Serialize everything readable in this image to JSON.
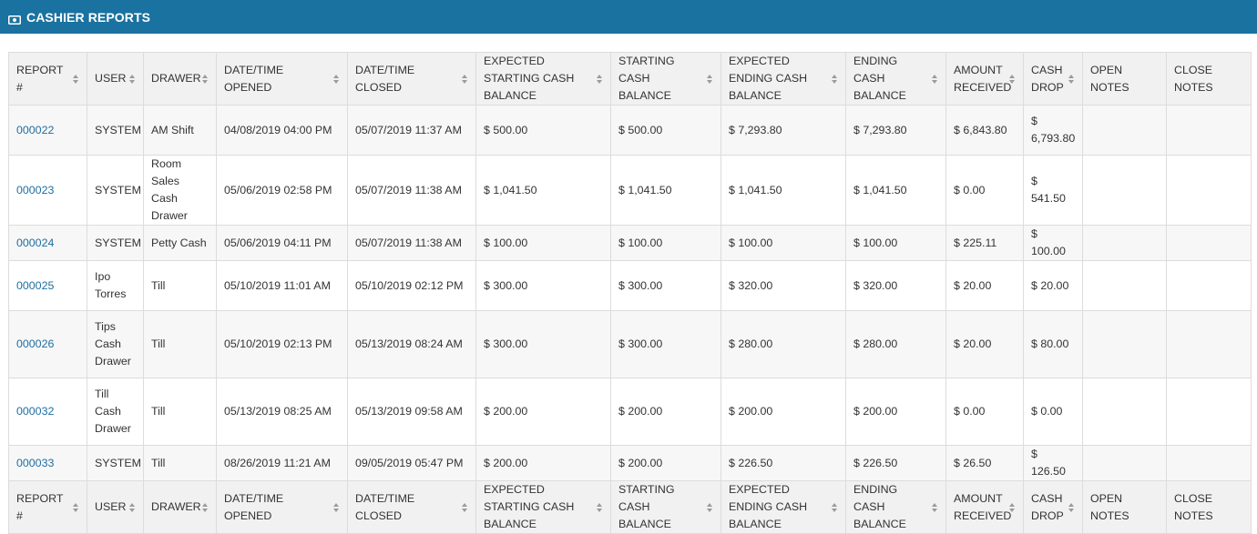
{
  "header": {
    "title": "CASHIER REPORTS",
    "icon": "money-icon"
  },
  "columns": [
    "REPORT #",
    "USER",
    "DRAWER",
    "DATE/TIME OPENED",
    "DATE/TIME CLOSED",
    "EXPECTED STARTING CASH BALANCE",
    "STARTING CASH BALANCE",
    "EXPECTED ENDING CASH BALANCE",
    "ENDING CASH BALANCE",
    "AMOUNT RECEIVED",
    "CASH DROP",
    "OPEN NOTES",
    "CLOSE NOTES"
  ],
  "rows": [
    {
      "report": "000022",
      "user": "SYSTEM",
      "drawer": "AM Shift",
      "opened": "04/08/2019 04:00 PM",
      "closed": "05/07/2019 11:37 AM",
      "exp_start": "$ 500.00",
      "start": "$ 500.00",
      "exp_end": "$ 7,293.80",
      "end": "$ 7,293.80",
      "received": "$ 6,843.80",
      "drop": "$ 6,793.80",
      "open_notes": "",
      "close_notes": ""
    },
    {
      "report": "000023",
      "user": "SYSTEM",
      "drawer": "Room Sales Cash Drawer",
      "opened": "05/06/2019 02:58 PM",
      "closed": "05/07/2019 11:38 AM",
      "exp_start": "$ 1,041.50",
      "start": "$ 1,041.50",
      "exp_end": "$ 1,041.50",
      "end": "$ 1,041.50",
      "received": "$ 0.00",
      "drop": "$ 541.50",
      "open_notes": "",
      "close_notes": ""
    },
    {
      "report": "000024",
      "user": "SYSTEM",
      "drawer": "Petty Cash",
      "opened": "05/06/2019 04:11 PM",
      "closed": "05/07/2019 11:38 AM",
      "exp_start": "$ 100.00",
      "start": "$ 100.00",
      "exp_end": "$ 100.00",
      "end": "$ 100.00",
      "received": "$ 225.11",
      "drop": "$ 100.00",
      "open_notes": "",
      "close_notes": ""
    },
    {
      "report": "000025",
      "user": "Ipo Torres",
      "drawer": "Till",
      "opened": "05/10/2019 11:01 AM",
      "closed": "05/10/2019 02:12 PM",
      "exp_start": "$ 300.00",
      "start": "$ 300.00",
      "exp_end": "$ 320.00",
      "end": "$ 320.00",
      "received": "$ 20.00",
      "drop": "$ 20.00",
      "open_notes": "",
      "close_notes": ""
    },
    {
      "report": "000026",
      "user": "Tips Cash Drawer",
      "drawer": "Till",
      "opened": "05/10/2019 02:13 PM",
      "closed": "05/13/2019 08:24 AM",
      "exp_start": "$ 300.00",
      "start": "$ 300.00",
      "exp_end": "$ 280.00",
      "end": "$ 280.00",
      "received": "$ 20.00",
      "drop": "$ 80.00",
      "open_notes": "",
      "close_notes": ""
    },
    {
      "report": "000032",
      "user": "Till Cash Drawer",
      "drawer": "Till",
      "opened": "05/13/2019 08:25 AM",
      "closed": "05/13/2019 09:58 AM",
      "exp_start": "$ 200.00",
      "start": "$ 200.00",
      "exp_end": "$ 200.00",
      "end": "$ 200.00",
      "received": "$ 0.00",
      "drop": "$ 0.00",
      "open_notes": "",
      "close_notes": ""
    },
    {
      "report": "000033",
      "user": "SYSTEM",
      "drawer": "Till",
      "opened": "08/26/2019 11:21 AM",
      "closed": "09/05/2019 05:47 PM",
      "exp_start": "$ 200.00",
      "start": "$ 200.00",
      "exp_end": "$ 226.50",
      "end": "$ 226.50",
      "received": "$ 26.50",
      "drop": "$ 126.50",
      "open_notes": "",
      "close_notes": ""
    }
  ]
}
